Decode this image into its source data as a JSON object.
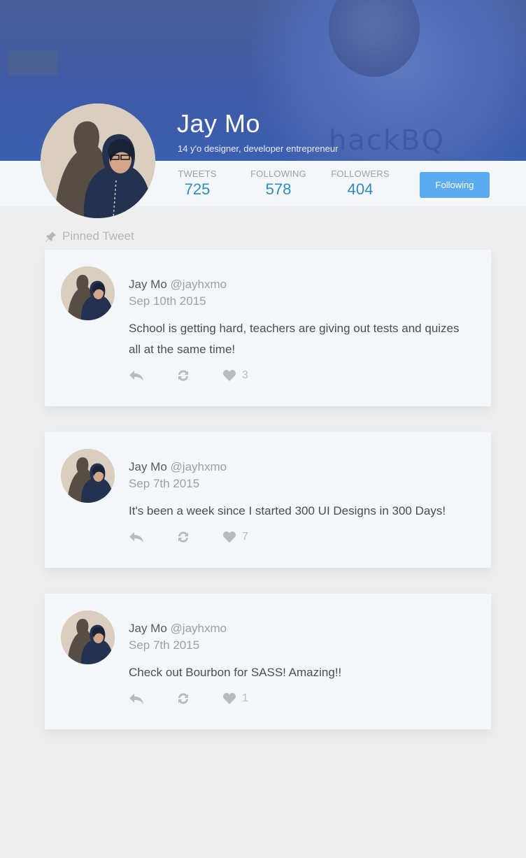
{
  "profile": {
    "name": "Jay Mo",
    "bio": "14 y'o designer, developer entrepreneur",
    "cover_text": "hackBQ",
    "follow_button_label": "Following"
  },
  "stats": [
    {
      "label": "TWEETS",
      "value": "725"
    },
    {
      "label": "FOLLOWING",
      "value": "578"
    },
    {
      "label": "FOLLOWERS",
      "value": "404"
    }
  ],
  "pinned_label": "Pinned Tweet",
  "tweets": [
    {
      "name": "Jay Mo",
      "handle": "@jayhxmo",
      "date": "Sep 10th 2015",
      "text": "School is getting hard, teachers are giving out tests and quizes all at the same time!",
      "likes": "3"
    },
    {
      "name": "Jay Mo",
      "handle": "@jayhxmo",
      "date": "Sep 7th 2015",
      "text": "It's been a week since I started 300 UI Designs in 300 Days!",
      "likes": "7"
    },
    {
      "name": "Jay Mo",
      "handle": "@jayhxmo",
      "date": "Sep 7th 2015",
      "text": "Check out Bourbon for SASS! Amazing!!",
      "likes": "1"
    }
  ],
  "colors": {
    "accent": "#5aacef",
    "stat_value": "#2f8bbf",
    "cover": "#3f5aa6"
  },
  "icons": {
    "pinned": "pin-icon",
    "reply": "reply-icon",
    "retweet": "retweet-icon",
    "like": "heart-icon"
  }
}
